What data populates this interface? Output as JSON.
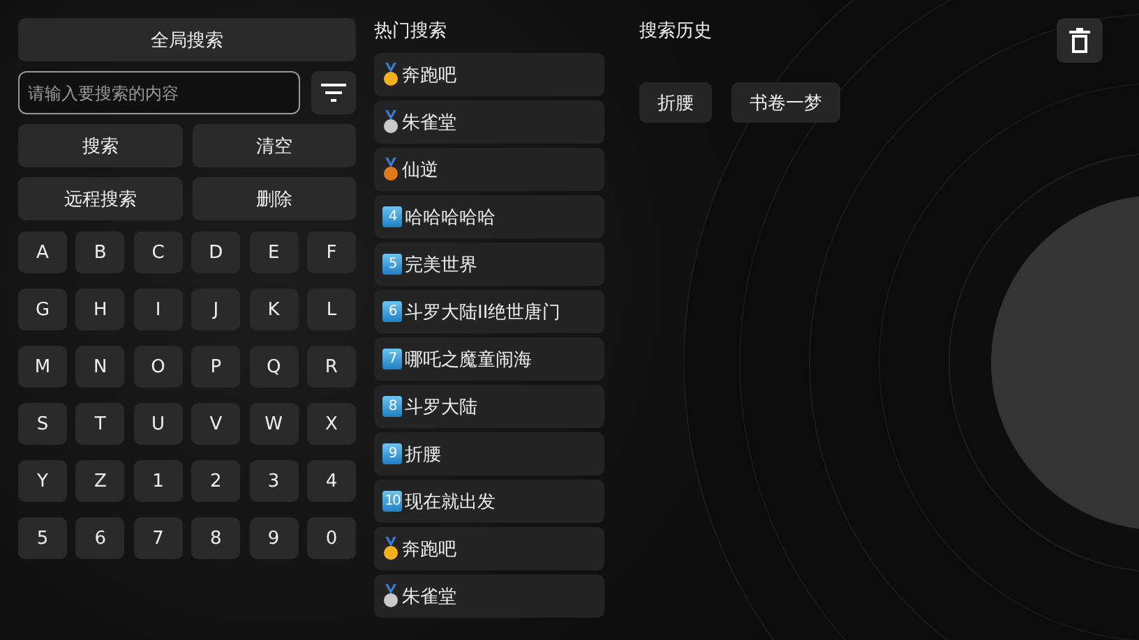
{
  "left_panel": {
    "global_search_button": "全局搜索",
    "search_field": {
      "placeholder": "请输入要搜索的内容"
    },
    "action_buttons": [
      "搜索",
      "清空",
      "远程搜索",
      "删除"
    ],
    "keys": [
      "A",
      "B",
      "C",
      "D",
      "E",
      "F",
      "G",
      "H",
      "I",
      "J",
      "K",
      "L",
      "M",
      "N",
      "O",
      "P",
      "Q",
      "R",
      "S",
      "T",
      "U",
      "V",
      "W",
      "X",
      "Y",
      "Z",
      "1",
      "2",
      "3",
      "4",
      "5",
      "6",
      "7",
      "8",
      "9",
      "0"
    ]
  },
  "hot_search": {
    "title": "热门搜索",
    "items": [
      {
        "kind": "medal",
        "color": "#f2b01e",
        "label": "奔跑吧"
      },
      {
        "kind": "medal",
        "color": "#c9c9c9",
        "label": "朱雀堂"
      },
      {
        "kind": "medal",
        "color": "#e07a1c",
        "label": "仙逆"
      },
      {
        "kind": "number",
        "badge": "4",
        "label": "哈哈哈哈哈"
      },
      {
        "kind": "number",
        "badge": "5",
        "label": "完美世界"
      },
      {
        "kind": "number",
        "badge": "6",
        "label": "斗罗大陆II绝世唐门"
      },
      {
        "kind": "number",
        "badge": "7",
        "label": "哪吒之魔童闹海"
      },
      {
        "kind": "number",
        "badge": "8",
        "label": "斗罗大陆"
      },
      {
        "kind": "number",
        "badge": "9",
        "label": "折腰"
      },
      {
        "kind": "number",
        "badge": "10",
        "label": "现在就出发"
      },
      {
        "kind": "medal",
        "color": "#f2b01e",
        "label": "奔跑吧"
      },
      {
        "kind": "medal",
        "color": "#c9c9c9",
        "label": "朱雀堂"
      }
    ]
  },
  "search_history": {
    "title": "搜索历史",
    "items": [
      "折腰",
      "书卷一梦"
    ]
  }
}
